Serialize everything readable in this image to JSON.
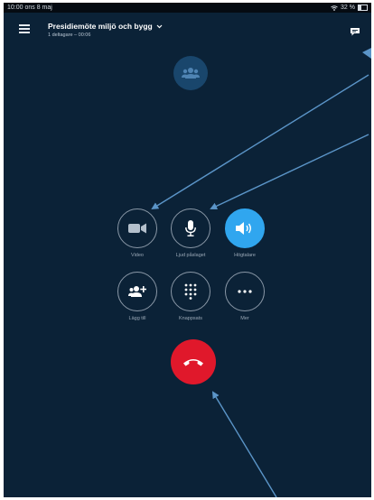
{
  "status_bar": {
    "time_date": "10:00  ons 8 maj",
    "battery": "32 %"
  },
  "header": {
    "title": "Presidiemöte miljö och bygg",
    "subtitle": "1 deltagare – 00:06"
  },
  "controls": {
    "video_label": "Video",
    "mute_label": "Ljud påslaget",
    "speaker_label": "Högtalare",
    "add_label": "Lägg till",
    "keypad_label": "Knappsats",
    "more_label": "Mer"
  },
  "icons": [
    "menu-icon",
    "chevron-down-icon",
    "chat-icon",
    "people-icon",
    "video-camera-icon",
    "microphone-icon",
    "speaker-icon",
    "add-person-icon",
    "keypad-icon",
    "more-icon",
    "end-call-icon"
  ],
  "colors": {
    "background": "#0b2237",
    "active": "#30a6ef",
    "end_call": "#e0182b",
    "annotation_arrow": "#5b95c8"
  }
}
